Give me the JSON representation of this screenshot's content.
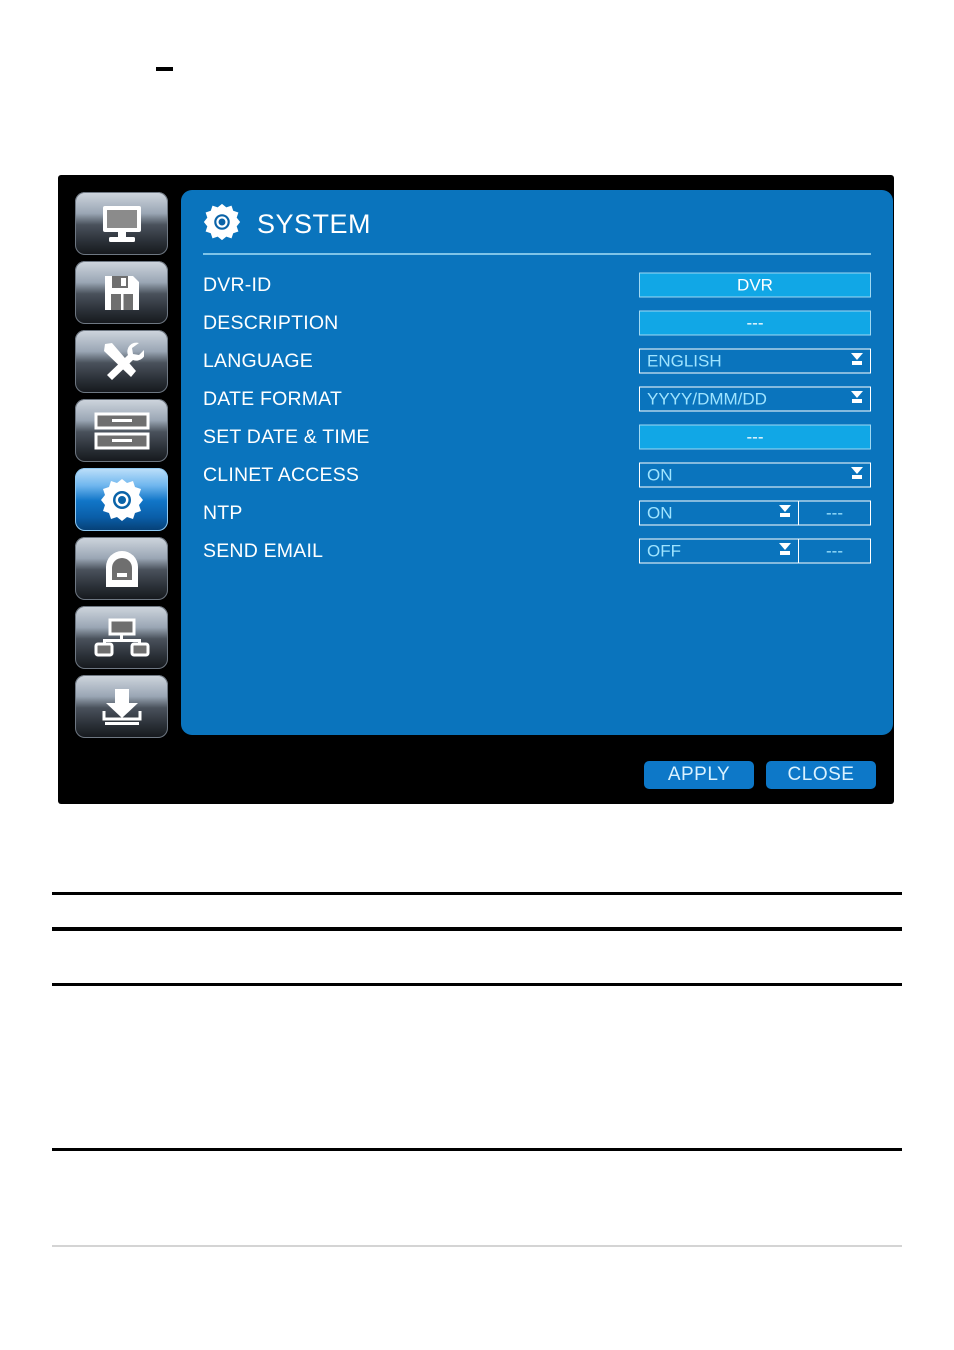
{
  "window": {
    "title": "SYSTEM",
    "title_icon": "gear-icon"
  },
  "sidebar": {
    "items": [
      {
        "icon": "monitor-icon",
        "name": "display",
        "selected": false
      },
      {
        "icon": "floppy-disk-icon",
        "name": "record",
        "selected": false
      },
      {
        "icon": "tools-icon",
        "name": "device",
        "selected": false
      },
      {
        "icon": "list-rows-icon",
        "name": "schedule",
        "selected": false
      },
      {
        "icon": "gear-icon",
        "name": "system",
        "selected": true
      },
      {
        "icon": "lock-icon",
        "name": "security",
        "selected": false
      },
      {
        "icon": "network-tree-icon",
        "name": "network",
        "selected": false
      },
      {
        "icon": "download-icon",
        "name": "backup",
        "selected": false
      }
    ]
  },
  "form": {
    "rows": [
      {
        "label": "DVR-ID",
        "type": "value",
        "value": "DVR"
      },
      {
        "label": "DESCRIPTION",
        "type": "value",
        "value": "---"
      },
      {
        "label": "LANGUAGE",
        "type": "select",
        "value": "ENGLISH"
      },
      {
        "label": "DATE FORMAT",
        "type": "select",
        "value": "YYYY/DMM/DD"
      },
      {
        "label": "SET DATE & TIME",
        "type": "value",
        "value": "---"
      },
      {
        "label": "CLINET ACCESS",
        "type": "select",
        "value": "ON"
      },
      {
        "label": "NTP",
        "type": "split",
        "value": "ON",
        "sub_value": "---"
      },
      {
        "label": "SEND EMAIL",
        "type": "split",
        "value": "OFF",
        "sub_value": "---"
      }
    ]
  },
  "buttons": {
    "apply": "APPLY",
    "close": "CLOSE"
  },
  "colors": {
    "panel_blue": "#0a74bd",
    "field_blue": "#11a7e6",
    "button_blue": "#0d78c8",
    "divider_blue": "#7fc4e8",
    "chrome_black": "#000000",
    "text_white": "#ffffff"
  }
}
